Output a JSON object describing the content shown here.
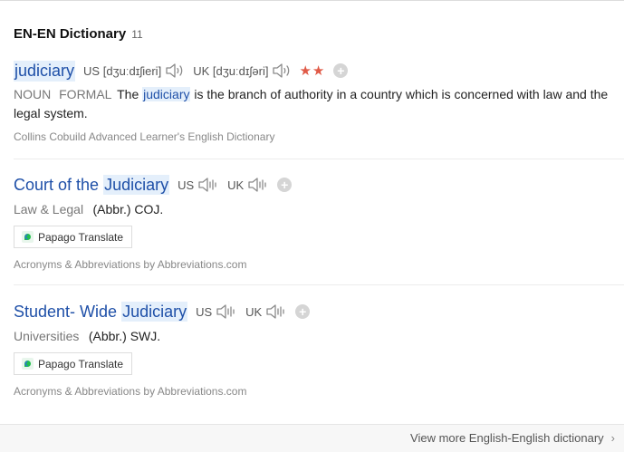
{
  "header": {
    "title": "EN-EN Dictionary",
    "count": "11"
  },
  "entries": [
    {
      "headword": "judiciary",
      "us_label": "US",
      "us_ipa": "[dʒuːdɪʃieri]",
      "uk_label": "UK",
      "uk_ipa": "[dʒuːdɪʃəri]",
      "stars": "★★",
      "pos": "NOUN",
      "register": "FORMAL",
      "def_pre": "The",
      "def_hl": "judiciary",
      "def_post": "is the branch of authority in a country which is concerned with law and the legal system.",
      "source": "Collins Cobuild Advanced Learner's English Dictionary"
    },
    {
      "headword_pre": "Court of the",
      "headword_hl": "Judiciary",
      "us_label": "US",
      "uk_label": "UK",
      "field": "Law & Legal",
      "abbr": "(Abbr.) COJ.",
      "translate": "Papago Translate",
      "source": "Acronyms & Abbreviations by Abbreviations.com"
    },
    {
      "headword_pre": "Student- Wide",
      "headword_hl": "Judiciary",
      "us_label": "US",
      "uk_label": "UK",
      "field": "Universities",
      "abbr": "(Abbr.) SWJ.",
      "translate": "Papago Translate",
      "source": "Acronyms & Abbreviations by Abbreviations.com"
    }
  ],
  "footer": {
    "more": "View more English-English dictionary"
  },
  "icons": {
    "speaker": "speaker-icon",
    "add": "plus-circle-icon",
    "translate": "papago-icon",
    "more": "chevron-right-icon"
  },
  "colors": {
    "headword": "#1f50a8",
    "highlight": "#e4effb",
    "stars": "#e05a47"
  }
}
